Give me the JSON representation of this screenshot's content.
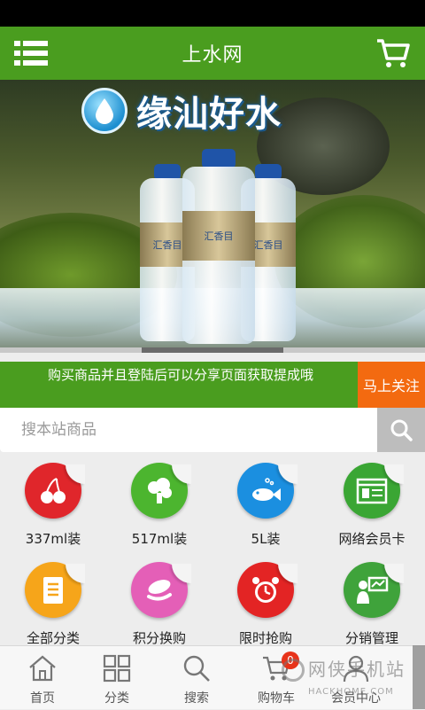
{
  "header": {
    "title": "上水网"
  },
  "banner": {
    "brand_text": "缘汕好水",
    "bottle_label": "汇香目"
  },
  "notice": {
    "text": "购买商品并且登陆后可以分享页面获取提成哦",
    "follow_label": "马上关注"
  },
  "search": {
    "placeholder": "搜本站商品"
  },
  "categories": [
    {
      "label": "337ml装",
      "icon": "cherry-icon",
      "color": "#e0262b"
    },
    {
      "label": "517ml装",
      "icon": "broccoli-icon",
      "color": "#4cb52f"
    },
    {
      "label": "5L装",
      "icon": "fish-icon",
      "color": "#1b8fe0"
    },
    {
      "label": "网络会员卡",
      "icon": "web-card-icon",
      "color": "#3aa634"
    },
    {
      "label": "全部分类",
      "icon": "list-icon",
      "color": "#f6a51a"
    },
    {
      "label": "积分换购",
      "icon": "coin-exchange-icon",
      "color": "#e45fb7"
    },
    {
      "label": "限时抢购",
      "icon": "alarm-clock-icon",
      "color": "#e32424"
    },
    {
      "label": "分销管理",
      "icon": "presenter-icon",
      "color": "#3fa33b"
    }
  ],
  "tabbar": [
    {
      "label": "首页",
      "icon": "home-icon"
    },
    {
      "label": "分类",
      "icon": "category-grid-icon"
    },
    {
      "label": "搜索",
      "icon": "search-icon"
    },
    {
      "label": "购物车",
      "icon": "cart-icon",
      "badge": "0"
    },
    {
      "label": "会员中心",
      "icon": "user-icon"
    }
  ],
  "watermark": {
    "line1": "网侠手机站",
    "line2": "HACKHOME.COM"
  }
}
